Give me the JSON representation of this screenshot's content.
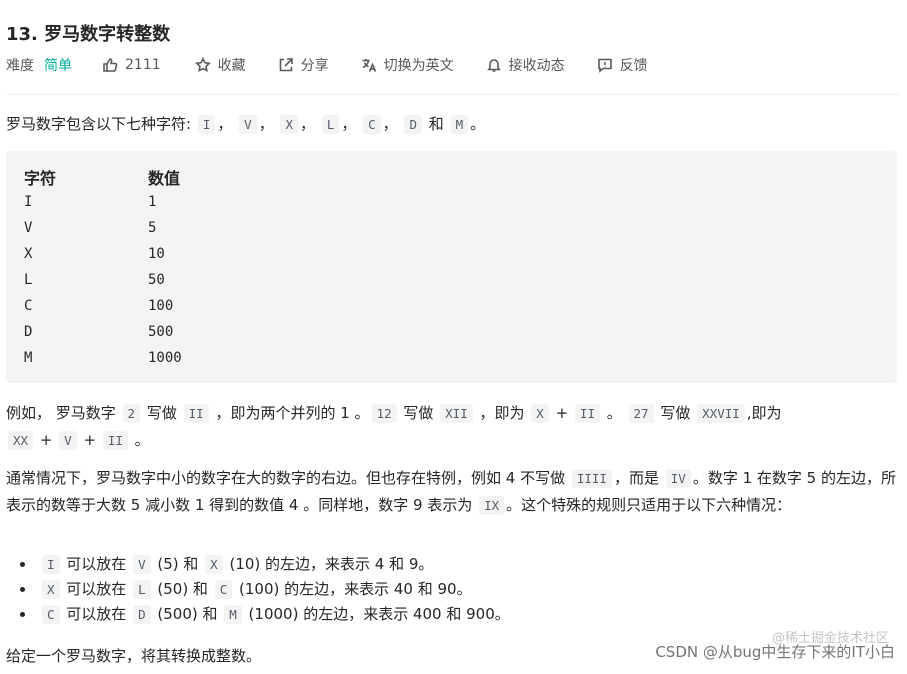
{
  "problem": {
    "title": "13. 罗马数字转整数",
    "difficulty_label": "难度",
    "difficulty": "简单",
    "likes": "2111",
    "favorite": "收藏",
    "share": "分享",
    "switch_lang": "切换为英文",
    "notify": "接收动态",
    "feedback": "反馈"
  },
  "intro": {
    "text_before": "罗马数字包含以下七种字符: ",
    "symbols": [
      "I",
      "V",
      "X",
      "L",
      "C",
      "D",
      "M"
    ],
    "sep": "，",
    "and": "和",
    "end": "。"
  },
  "table": {
    "headers": [
      "字符",
      "数值"
    ],
    "rows": [
      [
        "I",
        "1"
      ],
      [
        "V",
        "5"
      ],
      [
        "X",
        "10"
      ],
      [
        "L",
        "50"
      ],
      [
        "C",
        "100"
      ],
      [
        "D",
        "500"
      ],
      [
        "M",
        "1000"
      ]
    ]
  },
  "example": {
    "t1": "例如， 罗马数字 ",
    "c1": "2",
    "t2": " 写做 ",
    "c2": "II",
    "t3": " ，即为两个并列的 1 。",
    "c3": "12",
    "t4": " 写做 ",
    "c4": "XII",
    "t5": " ，即为 ",
    "c5": "X",
    "t6": " + ",
    "c6": "II",
    "t7": " 。 ",
    "c7": "27",
    "t8": " 写做  ",
    "c8": "XXVII",
    "t9": ",即为 ",
    "c9": "XX",
    "t10": " + ",
    "c10": "V",
    "t11": " + ",
    "c11": "II",
    "t12": " 。"
  },
  "special": {
    "t1": "通常情况下，罗马数字中小的数字在大的数字的右边。但也存在特例，例如 4 不写做 ",
    "c1": "IIII",
    "t2": "，而是 ",
    "c2": "IV",
    "t3": "。数字 1 在数字 5 的左边，所表示的数等于大数 5 减小数 1 得到的数值 4 。同样地，数字 9 表示为 ",
    "c3": "IX",
    "t4": "。这个特殊的规则只适用于以下六种情况："
  },
  "rules": [
    {
      "a": "I",
      "t1": " 可以放在 ",
      "b": "V",
      "t2": " (5) 和 ",
      "c": "X",
      "t3": " (10) 的左边，来表示 4 和 9。"
    },
    {
      "a": "X",
      "t1": " 可以放在 ",
      "b": "L",
      "t2": " (50) 和 ",
      "c": "C",
      "t3": " (100) 的左边，来表示 40 和 90。"
    },
    {
      "a": "C",
      "t1": " 可以放在 ",
      "b": "D",
      "t2": " (500) 和 ",
      "c": "M",
      "t3": " (1000) 的左边，来表示 400 和 900。"
    }
  ],
  "task": "给定一个罗马数字，将其转换成整数。",
  "watermark": {
    "line1": "@稀土掘金技术社区",
    "line2": "CSDN @从bug中生存下来的IT小白"
  },
  "colors": {
    "difficulty_easy": "#00af9b",
    "code_bg": "#f3f4f5"
  }
}
